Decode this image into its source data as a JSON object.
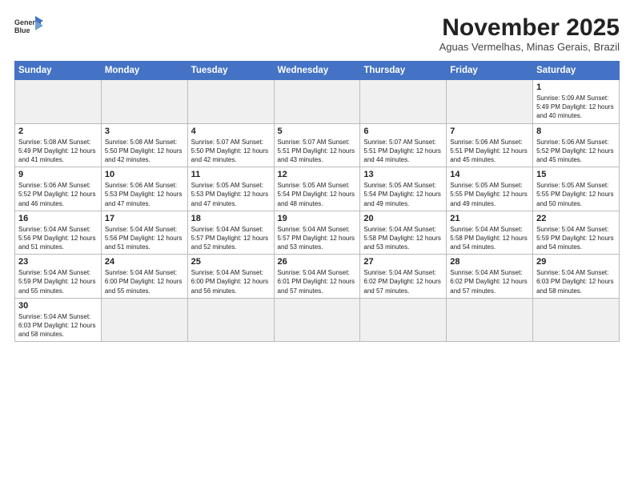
{
  "logo": {
    "line1": "General",
    "line2": "Blue"
  },
  "title": "November 2025",
  "subtitle": "Aguas Vermelhas, Minas Gerais, Brazil",
  "weekdays": [
    "Sunday",
    "Monday",
    "Tuesday",
    "Wednesday",
    "Thursday",
    "Friday",
    "Saturday"
  ],
  "weeks": [
    [
      {
        "day": "",
        "info": ""
      },
      {
        "day": "",
        "info": ""
      },
      {
        "day": "",
        "info": ""
      },
      {
        "day": "",
        "info": ""
      },
      {
        "day": "",
        "info": ""
      },
      {
        "day": "",
        "info": ""
      },
      {
        "day": "1",
        "info": "Sunrise: 5:09 AM\nSunset: 5:49 PM\nDaylight: 12 hours and 40 minutes."
      }
    ],
    [
      {
        "day": "2",
        "info": "Sunrise: 5:08 AM\nSunset: 5:49 PM\nDaylight: 12 hours and 41 minutes."
      },
      {
        "day": "3",
        "info": "Sunrise: 5:08 AM\nSunset: 5:50 PM\nDaylight: 12 hours and 42 minutes."
      },
      {
        "day": "4",
        "info": "Sunrise: 5:07 AM\nSunset: 5:50 PM\nDaylight: 12 hours and 42 minutes."
      },
      {
        "day": "5",
        "info": "Sunrise: 5:07 AM\nSunset: 5:51 PM\nDaylight: 12 hours and 43 minutes."
      },
      {
        "day": "6",
        "info": "Sunrise: 5:07 AM\nSunset: 5:51 PM\nDaylight: 12 hours and 44 minutes."
      },
      {
        "day": "7",
        "info": "Sunrise: 5:06 AM\nSunset: 5:51 PM\nDaylight: 12 hours and 45 minutes."
      },
      {
        "day": "8",
        "info": "Sunrise: 5:06 AM\nSunset: 5:52 PM\nDaylight: 12 hours and 45 minutes."
      }
    ],
    [
      {
        "day": "9",
        "info": "Sunrise: 5:06 AM\nSunset: 5:52 PM\nDaylight: 12 hours and 46 minutes."
      },
      {
        "day": "10",
        "info": "Sunrise: 5:06 AM\nSunset: 5:53 PM\nDaylight: 12 hours and 47 minutes."
      },
      {
        "day": "11",
        "info": "Sunrise: 5:05 AM\nSunset: 5:53 PM\nDaylight: 12 hours and 47 minutes."
      },
      {
        "day": "12",
        "info": "Sunrise: 5:05 AM\nSunset: 5:54 PM\nDaylight: 12 hours and 48 minutes."
      },
      {
        "day": "13",
        "info": "Sunrise: 5:05 AM\nSunset: 5:54 PM\nDaylight: 12 hours and 49 minutes."
      },
      {
        "day": "14",
        "info": "Sunrise: 5:05 AM\nSunset: 5:55 PM\nDaylight: 12 hours and 49 minutes."
      },
      {
        "day": "15",
        "info": "Sunrise: 5:05 AM\nSunset: 5:55 PM\nDaylight: 12 hours and 50 minutes."
      }
    ],
    [
      {
        "day": "16",
        "info": "Sunrise: 5:04 AM\nSunset: 5:56 PM\nDaylight: 12 hours and 51 minutes."
      },
      {
        "day": "17",
        "info": "Sunrise: 5:04 AM\nSunset: 5:56 PM\nDaylight: 12 hours and 51 minutes."
      },
      {
        "day": "18",
        "info": "Sunrise: 5:04 AM\nSunset: 5:57 PM\nDaylight: 12 hours and 52 minutes."
      },
      {
        "day": "19",
        "info": "Sunrise: 5:04 AM\nSunset: 5:57 PM\nDaylight: 12 hours and 53 minutes."
      },
      {
        "day": "20",
        "info": "Sunrise: 5:04 AM\nSunset: 5:58 PM\nDaylight: 12 hours and 53 minutes."
      },
      {
        "day": "21",
        "info": "Sunrise: 5:04 AM\nSunset: 5:58 PM\nDaylight: 12 hours and 54 minutes."
      },
      {
        "day": "22",
        "info": "Sunrise: 5:04 AM\nSunset: 5:59 PM\nDaylight: 12 hours and 54 minutes."
      }
    ],
    [
      {
        "day": "23",
        "info": "Sunrise: 5:04 AM\nSunset: 5:59 PM\nDaylight: 12 hours and 55 minutes."
      },
      {
        "day": "24",
        "info": "Sunrise: 5:04 AM\nSunset: 6:00 PM\nDaylight: 12 hours and 55 minutes."
      },
      {
        "day": "25",
        "info": "Sunrise: 5:04 AM\nSunset: 6:00 PM\nDaylight: 12 hours and 56 minutes."
      },
      {
        "day": "26",
        "info": "Sunrise: 5:04 AM\nSunset: 6:01 PM\nDaylight: 12 hours and 57 minutes."
      },
      {
        "day": "27",
        "info": "Sunrise: 5:04 AM\nSunset: 6:02 PM\nDaylight: 12 hours and 57 minutes."
      },
      {
        "day": "28",
        "info": "Sunrise: 5:04 AM\nSunset: 6:02 PM\nDaylight: 12 hours and 57 minutes."
      },
      {
        "day": "29",
        "info": "Sunrise: 5:04 AM\nSunset: 6:03 PM\nDaylight: 12 hours and 58 minutes."
      }
    ],
    [
      {
        "day": "30",
        "info": "Sunrise: 5:04 AM\nSunset: 6:03 PM\nDaylight: 12 hours and 58 minutes."
      },
      {
        "day": "",
        "info": ""
      },
      {
        "day": "",
        "info": ""
      },
      {
        "day": "",
        "info": ""
      },
      {
        "day": "",
        "info": ""
      },
      {
        "day": "",
        "info": ""
      },
      {
        "day": "",
        "info": ""
      }
    ]
  ]
}
